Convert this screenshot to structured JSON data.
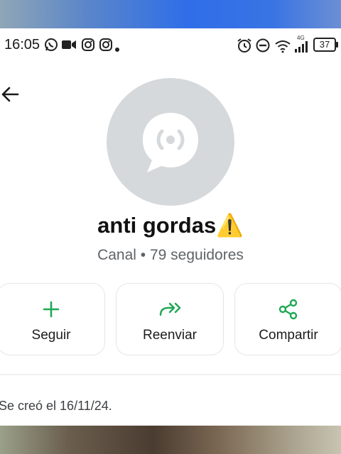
{
  "status_bar": {
    "time": "16:05",
    "left_icons": [
      "whatsapp-icon",
      "video-icon",
      "instagram-icon",
      "instagram-icon",
      "dot-icon"
    ],
    "right_icons": [
      "alarm-icon",
      "do-not-disturb-icon",
      "wifi-icon",
      "signal-icon"
    ],
    "network_label": "4G",
    "battery": "37"
  },
  "channel": {
    "name": "anti gordas",
    "name_emoji": "⚠️",
    "subtitle": "Canal • 79 seguidores",
    "created": "Se creó el 16/11/24."
  },
  "actions": [
    {
      "label": "Seguir",
      "icon": "plus-icon"
    },
    {
      "label": "Reenviar",
      "icon": "forward-icon"
    },
    {
      "label": "Compartir",
      "icon": "share-icon"
    }
  ],
  "colors": {
    "accent": "#1fa855",
    "avatar_bg": "#d5d9dc",
    "avatar_glyph": "#ffffff"
  }
}
